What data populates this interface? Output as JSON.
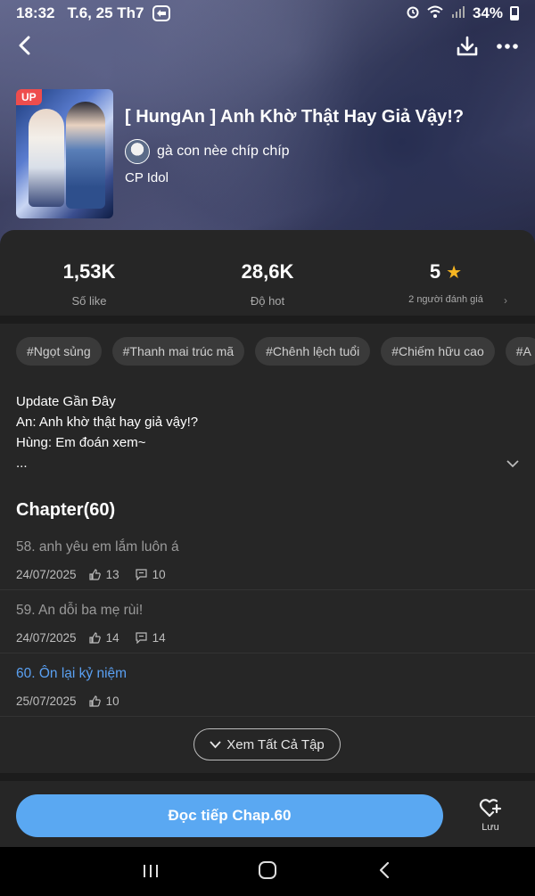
{
  "status_bar": {
    "time": "18:32",
    "date": "T.6, 25 Th7",
    "battery": "34%"
  },
  "story": {
    "badge": "UP",
    "title": "[ HungAn ] Anh Khờ Thật Hay Giả Vậy!?",
    "author": "gà con nèe chíp chíp",
    "genre": "CP Idol"
  },
  "stats": [
    {
      "value": "1,53K",
      "label": "Số like"
    },
    {
      "value": "28,6K",
      "label": "Độ hot"
    },
    {
      "value": "5",
      "label": "2 người đánh giá"
    }
  ],
  "tags": [
    "#Ngọt sủng",
    "#Thanh mai trúc mã",
    "#Chênh lệch tuổi",
    "#Chiếm hữu cao",
    "#A"
  ],
  "update": {
    "heading": "Update Gần Đây",
    "line1": "An: Anh khờ thật hay giả vậy!?",
    "line2": "Hùng: Em đoán xem~",
    "more": "..."
  },
  "chapters_heading": "Chapter(60)",
  "chapters": [
    {
      "title": "58. anh yêu em lắm luôn á",
      "date": "24/07/2025",
      "likes": "13",
      "comments": "10"
    },
    {
      "title": "59. An dỗi ba mẹ rùi!",
      "date": "24/07/2025",
      "likes": "14",
      "comments": "14"
    },
    {
      "title": "60. Ôn lại kỷ niệm",
      "date": "25/07/2025",
      "likes": "10"
    }
  ],
  "see_all_label": "Xem Tất Cả Tập",
  "read_button_label": "Đọc tiếp Chap.60",
  "save_label": "Lưu",
  "colors": {
    "accent": "#5aa8f2",
    "active_chapter": "#5aa0f2",
    "star": "#f6b521",
    "badge": "#ee4d4d"
  }
}
